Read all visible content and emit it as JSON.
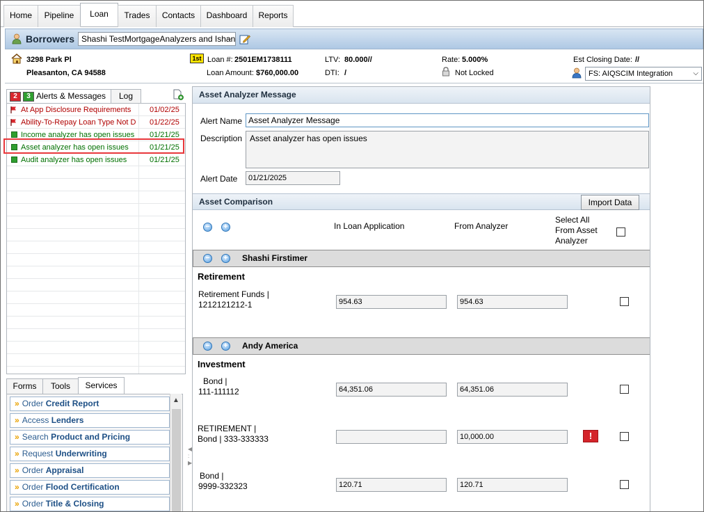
{
  "nav": {
    "tabs": [
      {
        "label": "Home"
      },
      {
        "label": "Pipeline"
      },
      {
        "label": "Loan",
        "active": true
      },
      {
        "label": "Trades"
      },
      {
        "label": "Contacts"
      },
      {
        "label": "Dashboard"
      },
      {
        "label": "Reports"
      }
    ]
  },
  "borrowers": {
    "title": "Borrowers",
    "selected": "Shashi TestMortgageAnalyzers and Ishan"
  },
  "summary": {
    "address_line1": "3298 Park Pl",
    "address_line2": "Pleasanton, CA 94588",
    "lien_badge": "1st",
    "loan_number_label": "Loan #:",
    "loan_number": "2501EM1738111",
    "loan_amount_label": "Loan Amount:",
    "loan_amount": "$760,000.00",
    "ltv_label": "LTV:",
    "ltv": "80.000//",
    "dti_label": "DTI:",
    "dti": "/",
    "rate_label": "Rate:",
    "rate": "5.000%",
    "lock_status": "Not Locked",
    "closing_label": "Est Closing Date:",
    "closing_value": "//",
    "assignee": "FS: AIQSCIM Integration"
  },
  "alerts": {
    "count_red": "2",
    "count_green": "3",
    "tab_alerts": "Alerts & Messages",
    "tab_log": "Log",
    "items": [
      {
        "name": "At App Disclosure Requirements",
        "date": "01/02/25",
        "type": "flag"
      },
      {
        "name": "Ability-To-Repay Loan Type Not D",
        "date": "01/22/25",
        "type": "flag"
      },
      {
        "name": "Income analyzer has open issues",
        "date": "01/21/25",
        "type": "msg"
      },
      {
        "name": "Asset analyzer has open issues",
        "date": "01/21/25",
        "type": "msg"
      },
      {
        "name": "Audit analyzer has open issues",
        "date": "01/21/25",
        "type": "msg"
      }
    ]
  },
  "bottom_tabs": {
    "forms": "Forms",
    "tools": "Tools",
    "services": "Services"
  },
  "services": [
    {
      "prefix": "Order",
      "bold": "Credit Report"
    },
    {
      "prefix": "Access",
      "bold": "Lenders"
    },
    {
      "prefix": "Search",
      "bold": "Product and Pricing"
    },
    {
      "prefix": "Request",
      "bold": "Underwriting"
    },
    {
      "prefix": "Order",
      "bold": "Appraisal"
    },
    {
      "prefix": "Order",
      "bold": "Flood Certification"
    },
    {
      "prefix": "Order",
      "bold": "Title & Closing"
    }
  ],
  "message": {
    "header": "Asset Analyzer Message",
    "alert_name_label": "Alert Name",
    "alert_name": "Asset Analyzer Message",
    "description_label": "Description",
    "description": "Asset analyzer has open issues",
    "alert_date_label": "Alert Date",
    "alert_date": "01/21/2025"
  },
  "comparison": {
    "header": "Asset Comparison",
    "import_button": "Import Data",
    "col_loan_app": "In Loan Application",
    "col_analyzer": "From Analyzer",
    "select_all_line1": "Select All",
    "select_all_line2": "From Asset",
    "select_all_line3": "Analyzer",
    "borrower1": {
      "name": "Shashi Firstimer",
      "category": "Retirement",
      "item_line1": "Retirement Funds |",
      "item_line2": "1212121212-1",
      "loan_value": "954.63",
      "analyzer_value": "954.63"
    },
    "borrower2": {
      "name": "Andy America",
      "category": "Investment",
      "item1_line1": "Bond |",
      "item1_line2": "111-111112",
      "item1_loan": "64,351.06",
      "item1_analyzer": "64,351.06",
      "item2_line1": "RETIREMENT |",
      "item2_line2": "Bond | 333-333333",
      "item2_loan": "",
      "item2_analyzer": "10,000.00",
      "item3_line1": "Bond |",
      "item3_line2": "9999-332323",
      "item3_loan": "120.71",
      "item3_analyzer": "120.71"
    }
  },
  "colors": {
    "accent_blue": "#aec8e4",
    "alert_red": "#b00000",
    "message_green": "#007000",
    "highlight": "#e8373b",
    "warning": "#d4242a"
  },
  "icons": {
    "borrower": "person-icon",
    "edit": "edit-pencil-icon",
    "home": "house-icon",
    "lock": "lock-icon",
    "assignee": "person-icon",
    "flag": "flag-icon",
    "message": "message-icon",
    "add": "add-document-icon",
    "collapse": "minus-circle-icon",
    "expand": "plus-circle-icon",
    "warning": "exclamation-icon"
  }
}
